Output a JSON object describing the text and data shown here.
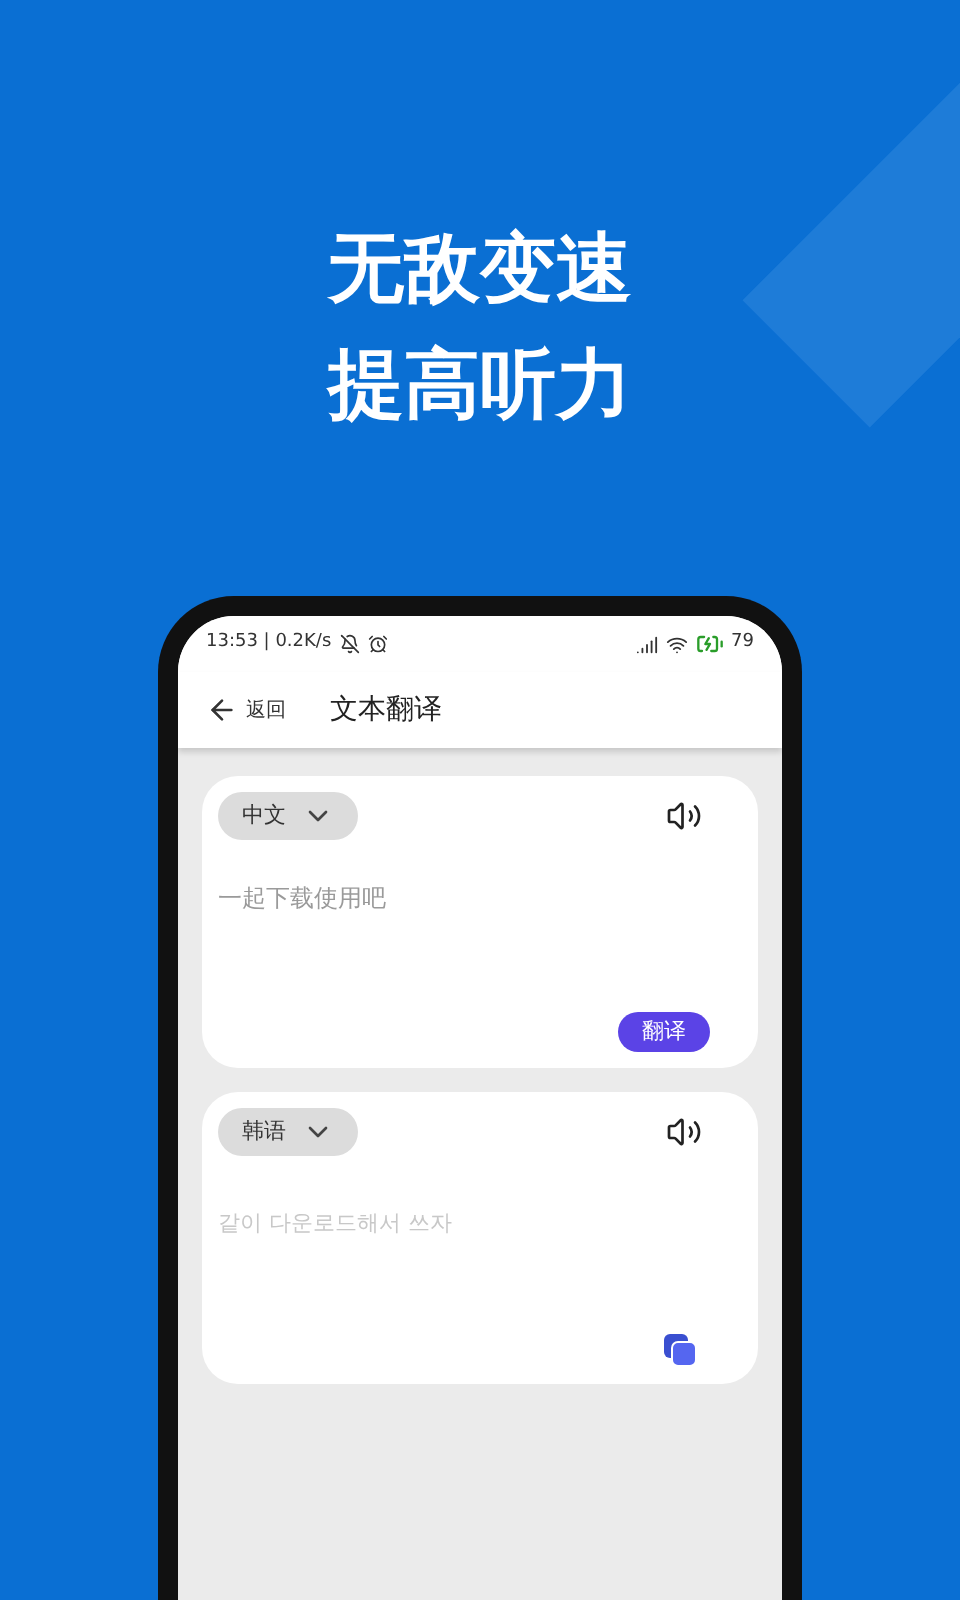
{
  "headline": [
    "无敌变速",
    "提高听力"
  ],
  "status_bar": {
    "time_and_speed": "13:53 | 0.2K/s",
    "battery": "79"
  },
  "header": {
    "back": "返回",
    "title": "文本翻译"
  },
  "source_card": {
    "language": "中文",
    "text": "一起下载使用吧",
    "translate_button": "翻译"
  },
  "target_card": {
    "language": "韩语",
    "text": "같이 다운로드해서 쓰자"
  }
}
